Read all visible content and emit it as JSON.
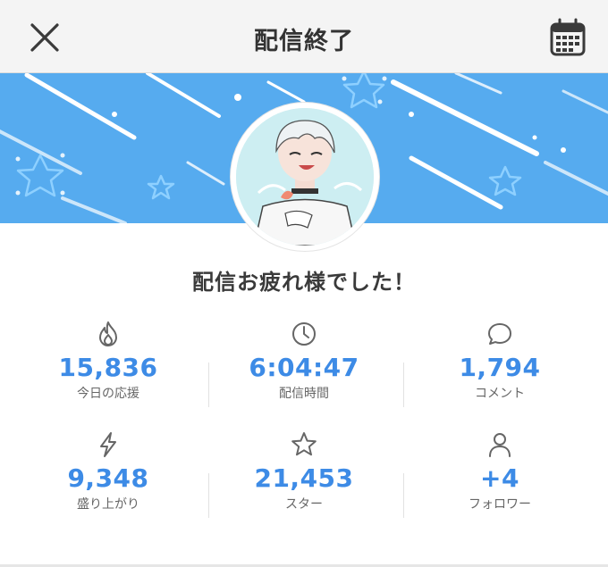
{
  "header": {
    "title": "配信終了",
    "close_icon": "close-icon",
    "calendar_icon": "calendar-icon"
  },
  "banner": {
    "color": "#56abef"
  },
  "message": "配信お疲れ様でした！",
  "stats": [
    {
      "icon": "flame-icon",
      "value": "15,836",
      "label": "今日の応援"
    },
    {
      "icon": "clock-icon",
      "value": "6:04:47",
      "label": "配信時間"
    },
    {
      "icon": "speech-bubble-icon",
      "value": "1,794",
      "label": "コメント"
    },
    {
      "icon": "lightning-icon",
      "value": "9,348",
      "label": "盛り上がり"
    },
    {
      "icon": "star-icon",
      "value": "21,453",
      "label": "スター"
    },
    {
      "icon": "person-icon",
      "value": "+4",
      "label": "フォロワー"
    }
  ],
  "colors": {
    "accent": "#3d8be6",
    "text": "#333333",
    "muted": "#666666"
  }
}
